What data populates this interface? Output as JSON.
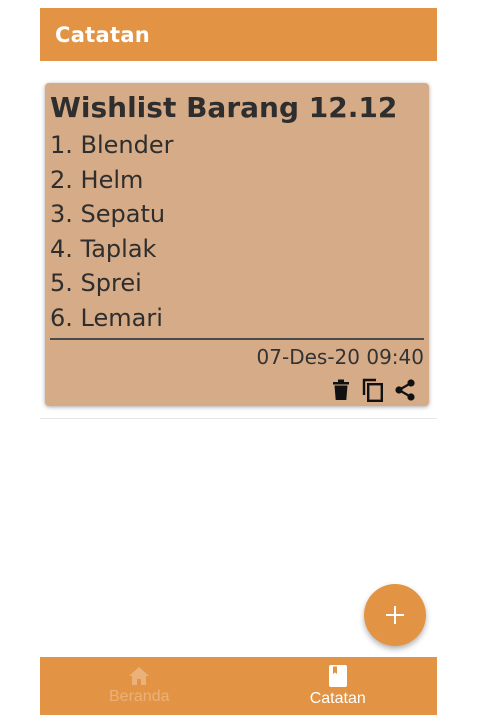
{
  "appbar": {
    "title": "Catatan"
  },
  "note": {
    "title": "Wishlist Barang 12.12",
    "lines": [
      "1. Blender",
      "2. Helm",
      "3. Sepatu",
      "4. Taplak",
      "5. Sprei",
      "6. Lemari"
    ],
    "date": "07-Des-20 09:40",
    "actions": [
      "delete-icon",
      "copy-icon",
      "share-icon"
    ]
  },
  "fab": {
    "icon": "plus-icon"
  },
  "bottom_nav": {
    "items": [
      {
        "label": "Beranda",
        "icon": "home-icon",
        "active": false
      },
      {
        "label": "Catatan",
        "icon": "book-icon",
        "active": true
      }
    ]
  },
  "colors": {
    "primary": "#e29444",
    "card": "#d6ab87",
    "text": "#2e2e2e",
    "nav_inactive": "#eab27a"
  }
}
